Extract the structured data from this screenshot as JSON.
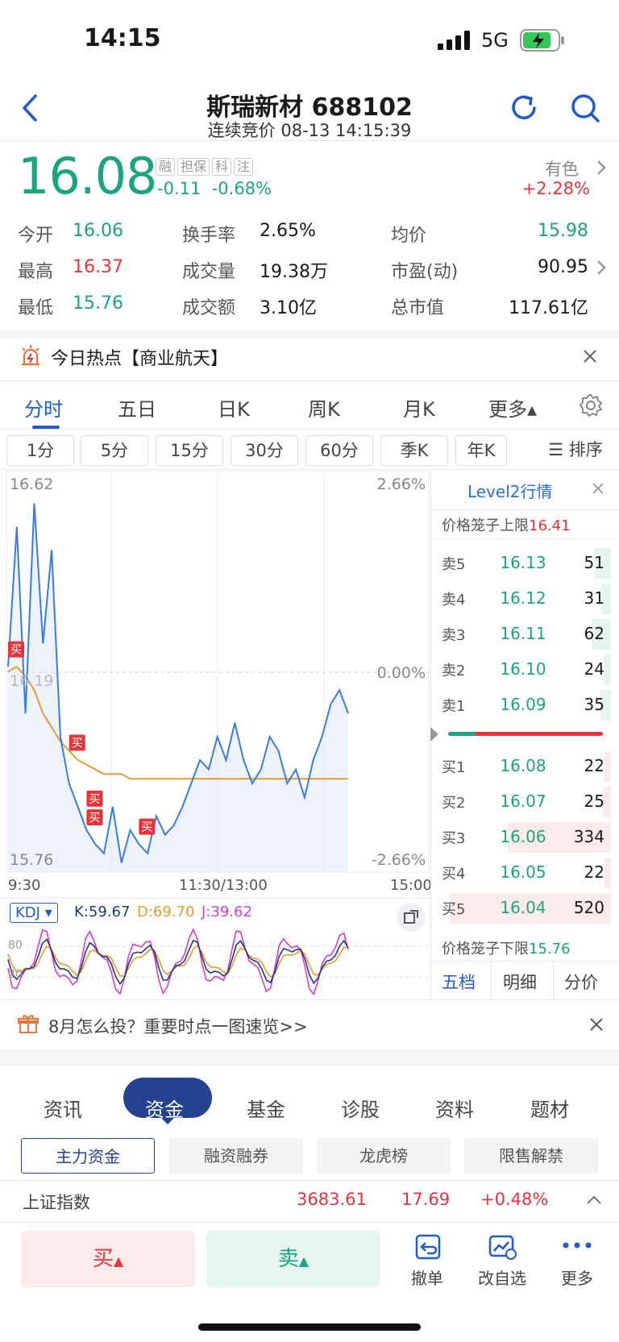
{
  "status": {
    "time": "14:15",
    "network": "5G"
  },
  "header": {
    "title": "斯瑞新材 688102",
    "subtitle": "连续竞价 08-13 14:15:39"
  },
  "quote": {
    "price": "16.08",
    "tags": [
      "融",
      "担保",
      "科",
      "注"
    ],
    "change": "-0.11",
    "change_pct": "-0.68%",
    "sector_name": "有色",
    "sector_pct": "+2.28%"
  },
  "stats": {
    "open_label": "今开",
    "open": "16.06",
    "high_label": "最高",
    "high": "16.37",
    "low_label": "最低",
    "low": "15.76",
    "turnover_rate_label": "换手率",
    "turnover_rate": "2.65%",
    "volume_label": "成交量",
    "volume": "19.38万",
    "amount_label": "成交额",
    "amount": "3.10亿",
    "avg_label": "均价",
    "avg": "15.98",
    "pe_label": "市盈(动)",
    "pe": "90.95",
    "mcap_label": "总市值",
    "mcap": "117.61亿"
  },
  "hot": {
    "text": "今日热点【商业航天】"
  },
  "tabs": [
    "分时",
    "五日",
    "日K",
    "周K",
    "月K",
    "更多▴"
  ],
  "chips": [
    "1分",
    "5分",
    "15分",
    "30分",
    "60分",
    "季K",
    "年K",
    "☰ 排序"
  ],
  "chart": {
    "y_top": "16.62",
    "y_bottom": "15.76",
    "y_mid": "16.19",
    "pct_top": "2.66%",
    "pct_mid": "0.00%",
    "pct_bottom": "-2.66%",
    "x_start": "9:30",
    "x_mid": "11:30/13:00",
    "x_end": "15:00",
    "buy_marker": "买"
  },
  "chart_data": {
    "type": "line",
    "series": [
      {
        "name": "",
        "values": [
          16.2,
          16.5,
          16.1,
          16.55,
          16.25,
          16.45,
          16.05,
          15.95,
          15.9,
          15.85,
          15.82,
          15.8,
          15.9,
          15.78,
          15.85,
          15.82,
          15.8,
          15.88,
          15.84,
          15.86,
          15.9,
          15.95,
          16.0,
          15.98,
          16.05,
          16.0,
          16.08,
          16.0,
          15.95,
          15.98,
          16.05,
          16.02,
          15.95,
          15.98,
          15.92,
          16.0,
          16.05,
          16.12,
          16.15,
          16.1
        ]
      },
      {
        "name": "",
        "values": [
          16.19,
          16.2,
          16.18,
          16.15,
          16.1,
          16.07,
          16.04,
          16.02,
          16.0,
          15.99,
          15.98,
          15.97,
          15.97,
          15.97,
          15.96,
          15.96,
          15.96,
          15.96,
          15.96,
          15.96,
          15.96,
          15.96,
          15.96,
          15.96,
          15.96,
          15.96,
          15.96,
          15.96,
          15.96,
          15.96,
          15.96,
          15.96,
          15.96,
          15.96,
          15.96,
          15.96,
          15.96,
          15.96,
          15.96,
          15.96
        ]
      }
    ],
    "ylim": [
      15.76,
      16.62
    ],
    "xlabel": "",
    "ylabel": ""
  },
  "kdj": {
    "label": "KDJ ▾",
    "k": "K:59.67",
    "d": "D:69.70",
    "j": "J:39.62",
    "level_top": "80",
    "level_bottom": "20"
  },
  "orderbook": {
    "title": "Level2行情",
    "upper_limit_label": "价格笼子上限",
    "upper_limit": "16.41",
    "lower_limit_label": "价格笼子下限",
    "lower_limit": "15.76",
    "asks": [
      {
        "label": "卖5",
        "price": "16.13",
        "vol": "51"
      },
      {
        "label": "卖4",
        "price": "16.12",
        "vol": "31"
      },
      {
        "label": "卖3",
        "price": "16.11",
        "vol": "62"
      },
      {
        "label": "卖2",
        "price": "16.10",
        "vol": "24"
      },
      {
        "label": "卖1",
        "price": "16.09",
        "vol": "35"
      }
    ],
    "bids": [
      {
        "label": "买1",
        "price": "16.08",
        "vol": "22"
      },
      {
        "label": "买2",
        "price": "16.07",
        "vol": "25"
      },
      {
        "label": "买3",
        "price": "16.06",
        "vol": "334"
      },
      {
        "label": "买4",
        "price": "16.05",
        "vol": "22"
      },
      {
        "label": "买5",
        "price": "16.04",
        "vol": "520"
      }
    ],
    "tabs": [
      "五档",
      "明细",
      "分价"
    ]
  },
  "promo": {
    "text": "8月怎么投？重要时点一图速览>>"
  },
  "bottom_tabs": [
    "资讯",
    "资金",
    "基金",
    "诊股",
    "资料",
    "题材"
  ],
  "sub_tabs": [
    "主力资金",
    "融资融券",
    "龙虎榜",
    "限售解禁"
  ],
  "index": {
    "name": "上证指数",
    "value": "3683.61",
    "change": "17.69",
    "pct": "+0.48%"
  },
  "toolbar": {
    "buy": "买",
    "sell": "卖",
    "cancel": "撤单",
    "watch": "改自选",
    "more": "更多"
  },
  "colors": {
    "green": "#1aa57f",
    "red": "#e8333b",
    "blue": "#1f5bcc"
  }
}
